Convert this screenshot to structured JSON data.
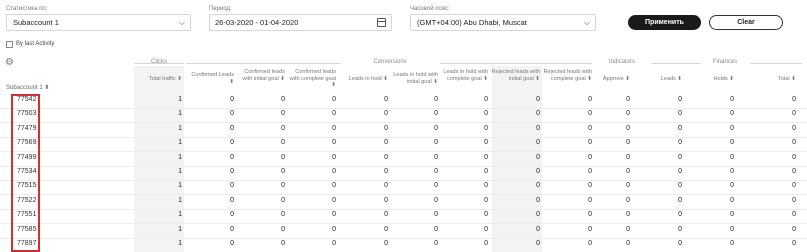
{
  "filters": {
    "stat_label": "Статистика по:",
    "stat_value": "Subaccount 1",
    "period_label": "Период:",
    "period_value": "26-03-2020 - 01-04-2020",
    "timezone_label": "Часовой пояс:",
    "timezone_value": "(GMT+04:00) Abu Dhabi, Muscat",
    "apply_label": "Применить",
    "clear_label": "Clear",
    "last_activity_label": "By last Activity"
  },
  "table": {
    "groups": {
      "clicks": "Clicks",
      "conversions": "Conversions",
      "indicators": "Indicators",
      "finances": "Finances"
    },
    "row_header": "Subaccount 1",
    "columns": [
      "Total traffic",
      "Confirmed Leads",
      "Confirmed leads with initial goal",
      "Confirmed leads with complete goal",
      "Leads in hold",
      "Leads in hold with initial goal",
      "Leads in hold with complete goal",
      "Rejected leads with initial goal",
      "Rejected leads with complete goal",
      "Approve",
      "Leads",
      "Holds",
      "Total"
    ],
    "rows": [
      {
        "id": "77542",
        "values": [
          "1",
          "0",
          "0",
          "0",
          "0",
          "0",
          "0",
          "0",
          "0",
          "0",
          "0",
          "0",
          "0"
        ]
      },
      {
        "id": "77503",
        "values": [
          "1",
          "0",
          "0",
          "0",
          "0",
          "0",
          "0",
          "0",
          "0",
          "0",
          "0",
          "0",
          "0"
        ]
      },
      {
        "id": "77479",
        "values": [
          "1",
          "0",
          "0",
          "0",
          "0",
          "0",
          "0",
          "0",
          "0",
          "0",
          "0",
          "0",
          "0"
        ]
      },
      {
        "id": "77569",
        "values": [
          "1",
          "0",
          "0",
          "0",
          "0",
          "0",
          "0",
          "0",
          "0",
          "0",
          "0",
          "0",
          "0"
        ]
      },
      {
        "id": "77499",
        "values": [
          "1",
          "0",
          "0",
          "0",
          "0",
          "0",
          "0",
          "0",
          "0",
          "0",
          "0",
          "0",
          "0"
        ]
      },
      {
        "id": "77534",
        "values": [
          "1",
          "0",
          "0",
          "0",
          "0",
          "0",
          "0",
          "0",
          "0",
          "0",
          "0",
          "0",
          "0"
        ]
      },
      {
        "id": "77515",
        "values": [
          "1",
          "0",
          "0",
          "0",
          "0",
          "0",
          "0",
          "0",
          "0",
          "0",
          "0",
          "0",
          "0"
        ]
      },
      {
        "id": "77522",
        "values": [
          "1",
          "0",
          "0",
          "0",
          "0",
          "0",
          "0",
          "0",
          "0",
          "0",
          "0",
          "0",
          "0"
        ]
      },
      {
        "id": "77551",
        "values": [
          "1",
          "0",
          "0",
          "0",
          "0",
          "0",
          "0",
          "0",
          "0",
          "0",
          "0",
          "0",
          "0"
        ]
      },
      {
        "id": "77585",
        "values": [
          "1",
          "0",
          "0",
          "0",
          "0",
          "0",
          "0",
          "0",
          "0",
          "0",
          "0",
          "0",
          "0"
        ]
      },
      {
        "id": "77897",
        "values": [
          "1",
          "0",
          "0",
          "0",
          "0",
          "0",
          "0",
          "0",
          "0",
          "0",
          "0",
          "0",
          "0"
        ]
      }
    ]
  },
  "colors": {
    "highlight": "#d32f2f",
    "primary_button": "#1a1a1a"
  },
  "icons": [
    "chevron-down-icon",
    "calendar-icon",
    "gear-icon",
    "checkbox-icon",
    "sort-icon"
  ]
}
